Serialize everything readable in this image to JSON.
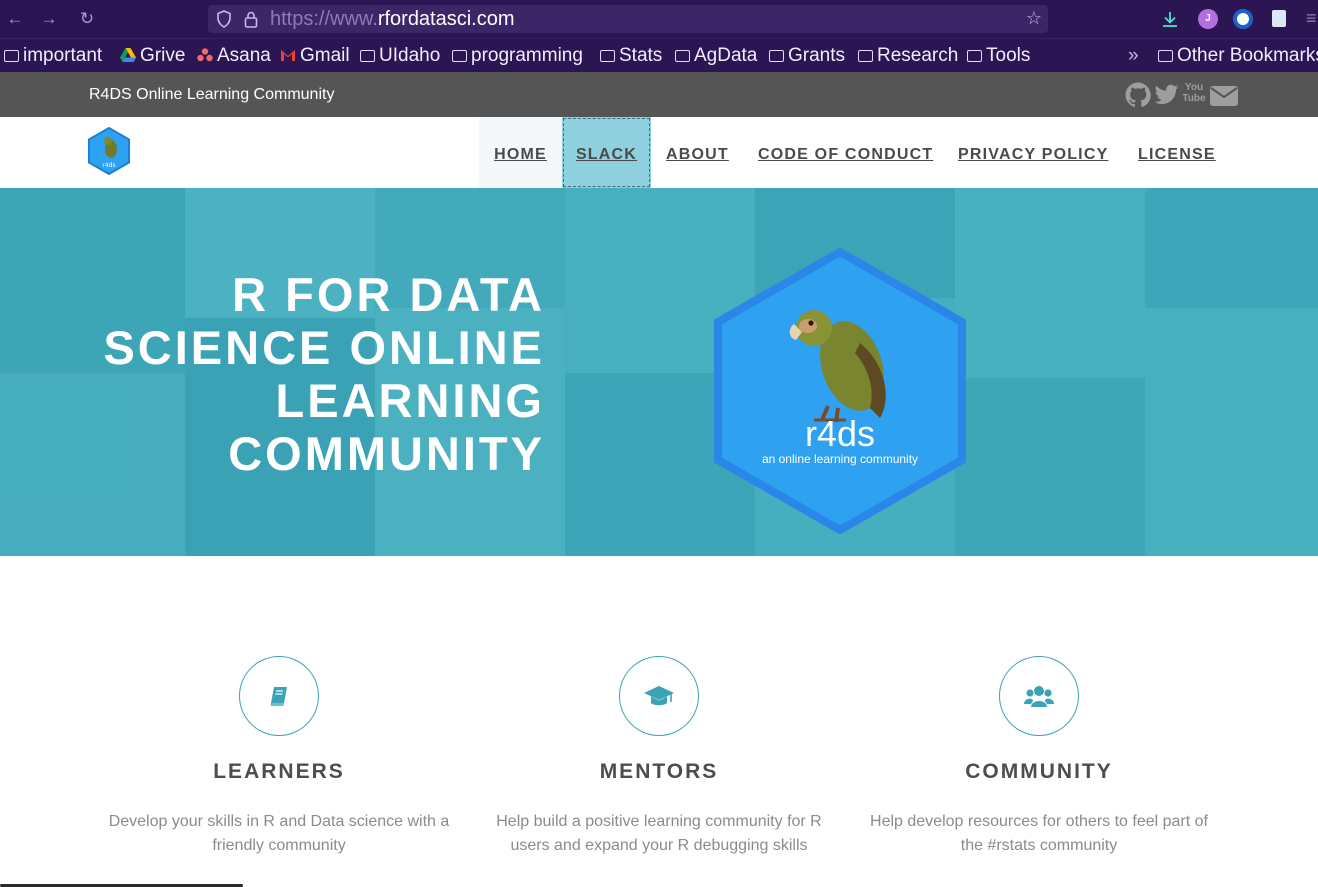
{
  "browser": {
    "url_prefix": "https://www.",
    "url_domain": "rfordatasci.com",
    "extension_j_label": "J"
  },
  "bookmarks": [
    {
      "label": "important",
      "type": "folder"
    },
    {
      "label": "Grive",
      "type": "drive"
    },
    {
      "label": "Asana",
      "type": "asana"
    },
    {
      "label": "Gmail",
      "type": "gmail"
    },
    {
      "label": "UIdaho",
      "type": "folder"
    },
    {
      "label": "programming",
      "type": "folder"
    },
    {
      "label": "Stats",
      "type": "folder"
    },
    {
      "label": "AgData",
      "type": "folder"
    },
    {
      "label": "Grants",
      "type": "folder"
    },
    {
      "label": "Research",
      "type": "folder"
    },
    {
      "label": "Tools",
      "type": "folder"
    }
  ],
  "bookmarks_overflow": "Other Bookmarks",
  "site": {
    "top_title": "R4DS Online Learning Community",
    "social_icons": [
      "github-icon",
      "twitter-icon",
      "youtube-icon",
      "envelope-icon"
    ],
    "youtube_text": "You Tube",
    "nav": [
      {
        "label": "HOME"
      },
      {
        "label": "SLACK"
      },
      {
        "label": "ABOUT"
      },
      {
        "label": "CODE OF CONDUCT"
      },
      {
        "label": "PRIVACY POLICY"
      },
      {
        "label": "LICENSE"
      }
    ],
    "logo_text": "r4ds"
  },
  "hero": {
    "title": "R FOR DATA SCIENCE ONLINE LEARNING COMMUNITY",
    "hex_title": "r4ds",
    "hex_subtitle": "an online learning community"
  },
  "features": [
    {
      "icon": "book-icon",
      "title": "LEARNERS",
      "text": "Develop your skills in R and Data science with a friendly community"
    },
    {
      "icon": "graduation-cap-icon",
      "title": "MENTORS",
      "text": "Help build a positive learning community for R users and expand your R debugging skills"
    },
    {
      "icon": "users-icon",
      "title": "COMMUNITY",
      "text": "Help develop resources for others to feel part of the #rstats community"
    }
  ],
  "colors": {
    "browser_chrome": "#2b1552",
    "site_top_bar": "#555555",
    "accent": "#3aa3b5",
    "hero_teal": "#49b1c2",
    "hex_blue": "#2ea1f0",
    "slack_highlight": "#8fd0df"
  }
}
